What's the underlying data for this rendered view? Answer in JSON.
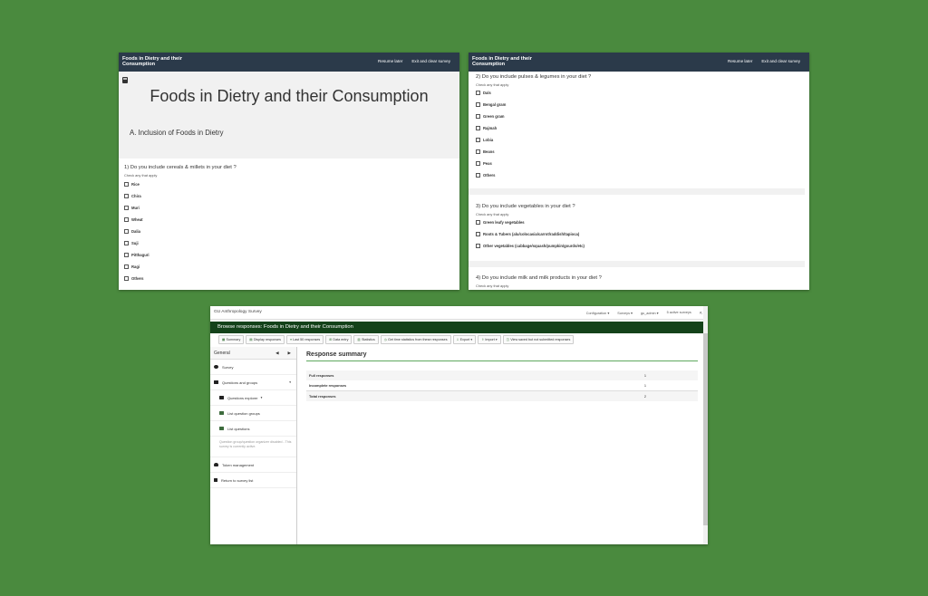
{
  "survey": {
    "brand": "Foods in Dietry and their Consumption",
    "resume_later": "Resume later",
    "exit_clear": "Exit and clear survey",
    "title": "Foods in Dietry and their Consumption",
    "section": "A. Inclusion of Foods in Dietry",
    "check_hint": "Check any that apply",
    "q1": {
      "text": "1) Do you include cereals & millets in your diet ?",
      "options": [
        "Rice",
        "Chira",
        "Muri",
        "Wheat",
        "Dalia",
        "Suji",
        "Pitthaguri",
        "Ragi",
        "Others"
      ]
    },
    "q2": {
      "text": "2) Do you include pulses & legumes in your diet ?",
      "options": [
        "Dals",
        "Bengal gram",
        "Green gram",
        "Rajmah",
        "Lobia",
        "Beans",
        "Peas",
        "Others"
      ]
    },
    "q3": {
      "text": "3) Do you include vegetables in your diet ?",
      "options": [
        "Green leafy vegetables",
        "Roots & Tubers (alu/colocasia/carrot/raddish/tapioca)",
        "Other vegetables (cabbage/squash/pumpkin/gourds/etc)"
      ]
    },
    "q4": {
      "text": "4) Do you include milk and milk products in your diet ?"
    }
  },
  "admin": {
    "app_title": "GU Anthropology Survey",
    "topnav": [
      "Configuration ▾",
      "Surveys ▾",
      "gu_admin ▾",
      "5 active surveys",
      "⇱"
    ],
    "header": "Browse responses: Foods in Dietry and their Consumption",
    "toolbar": [
      {
        "icon": "▦",
        "label": "Summary"
      },
      {
        "icon": "▤",
        "label": "Display responses"
      },
      {
        "icon": "≡",
        "label": "Last 50 responses"
      },
      {
        "icon": "⊞",
        "label": "Data entry"
      },
      {
        "icon": "▥",
        "label": "Statistics"
      },
      {
        "icon": "◷",
        "label": "Get time statistics from these responses"
      },
      {
        "icon": "⇩",
        "label": "Export ▾"
      },
      {
        "icon": "⇧",
        "label": "Import ▾"
      },
      {
        "icon": "◫",
        "label": "View saved but not submitted responses"
      }
    ],
    "sidebar": {
      "header": "General",
      "prev": "◀",
      "next": "▶",
      "items": {
        "survey": "Survey",
        "questions_groups": "Questions and groups",
        "questions_explorer": "Questions explorer",
        "list_question_groups": "List question groups",
        "list_questions": "List questions",
        "note": "Question group/question organizer disabled - This survey is currently active.",
        "token_management": "Token management",
        "return_list": "Return to survey list"
      },
      "caret": "▾",
      "collapse": "▸"
    },
    "summary": {
      "title": "Response summary",
      "rows": [
        {
          "label": "Full responses",
          "value": "1"
        },
        {
          "label": "Incomplete responses",
          "value": "1"
        },
        {
          "label": "Total responses",
          "value": "2"
        }
      ]
    }
  },
  "colors": {
    "background": "#4a8a3e",
    "survey_nav": "#2b3a4a",
    "admin_header": "#14421a",
    "accent": "#5fa85f"
  }
}
